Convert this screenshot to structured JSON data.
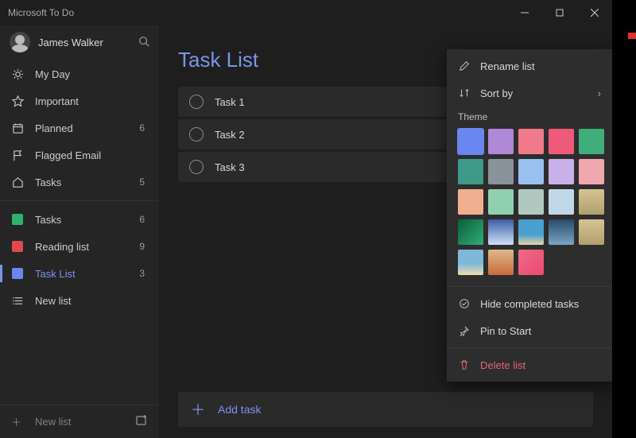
{
  "window": {
    "title": "Microsoft To Do"
  },
  "profile": {
    "name": "James Walker"
  },
  "smartLists": [
    {
      "icon": "sun",
      "label": "My Day",
      "count": ""
    },
    {
      "icon": "star",
      "label": "Important",
      "count": ""
    },
    {
      "icon": "calendar",
      "label": "Planned",
      "count": "6"
    },
    {
      "icon": "flag",
      "label": "Flagged Email",
      "count": ""
    },
    {
      "icon": "home",
      "label": "Tasks",
      "count": "5"
    }
  ],
  "userLists": [
    {
      "color": "#2fb36a",
      "label": "Tasks",
      "count": "6",
      "active": false
    },
    {
      "color": "#e04a4a",
      "label": "Reading list",
      "count": "9",
      "active": false
    },
    {
      "color": "#6a86f0",
      "label": "Task List",
      "count": "3",
      "active": true
    },
    {
      "color": "",
      "label": "New list",
      "count": "",
      "active": false
    }
  ],
  "addList": {
    "label": "New list"
  },
  "main": {
    "title": "Task List",
    "addTask": "Add task",
    "tasks": [
      {
        "title": "Task 1"
      },
      {
        "title": "Task 2"
      },
      {
        "title": "Task 3"
      }
    ]
  },
  "menu": {
    "rename": "Rename list",
    "sort": "Sort by",
    "themeLabel": "Theme",
    "hideCompleted": "Hide completed tasks",
    "pin": "Pin to Start",
    "delete": "Delete list",
    "swatches": [
      {
        "color": "#6a86f0",
        "selected": true
      },
      {
        "color": "#b088d8"
      },
      {
        "color": "#f07a8a"
      },
      {
        "color": "#f05a7a"
      },
      {
        "color": "#3fae7a"
      },
      {
        "color": "#3f9a8a"
      },
      {
        "color": "#8a929a"
      },
      {
        "color": "#9ac0f0"
      },
      {
        "color": "#c8b0e8"
      },
      {
        "color": "#f0a8b0"
      },
      {
        "color": "#f0b090"
      },
      {
        "color": "#90d0b0"
      },
      {
        "color": "#b0c8c0"
      },
      {
        "color": "#c0d8e8"
      },
      {
        "photo": "ph5"
      },
      {
        "photo": "ph1"
      },
      {
        "photo": "ph2"
      },
      {
        "photo": "ph3"
      },
      {
        "photo": "ph4"
      },
      {
        "photo": "ph5"
      },
      {
        "photo": "ph6"
      },
      {
        "photo": "ph7"
      },
      {
        "photo": "ph8"
      }
    ]
  }
}
